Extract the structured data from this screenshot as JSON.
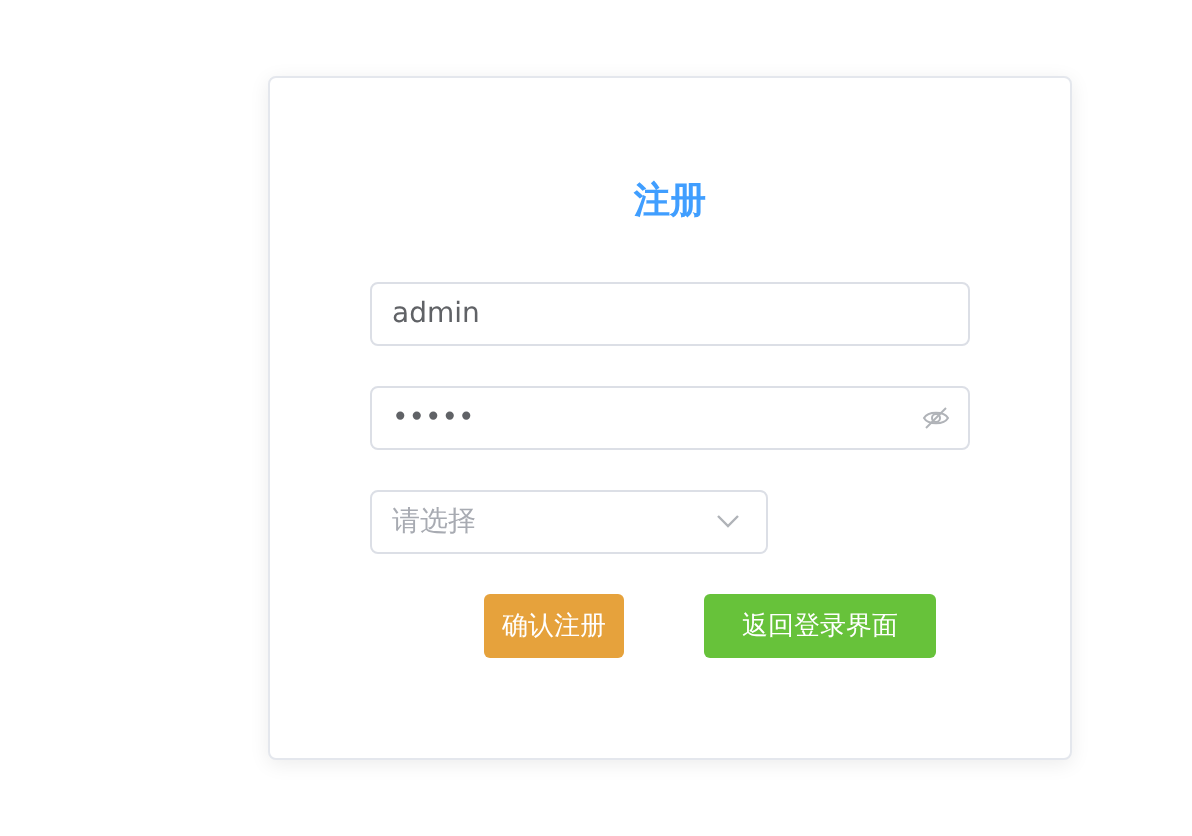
{
  "card": {
    "title": "注册"
  },
  "fields": [
    {
      "kind": "text",
      "value": "admin"
    },
    {
      "kind": "password",
      "value": "•••••"
    },
    {
      "kind": "select",
      "placeholder": "请选择"
    }
  ],
  "buttons": [
    {
      "kind": "warning",
      "label": "确认注册"
    },
    {
      "kind": "success",
      "label": "返回登录界面"
    }
  ]
}
